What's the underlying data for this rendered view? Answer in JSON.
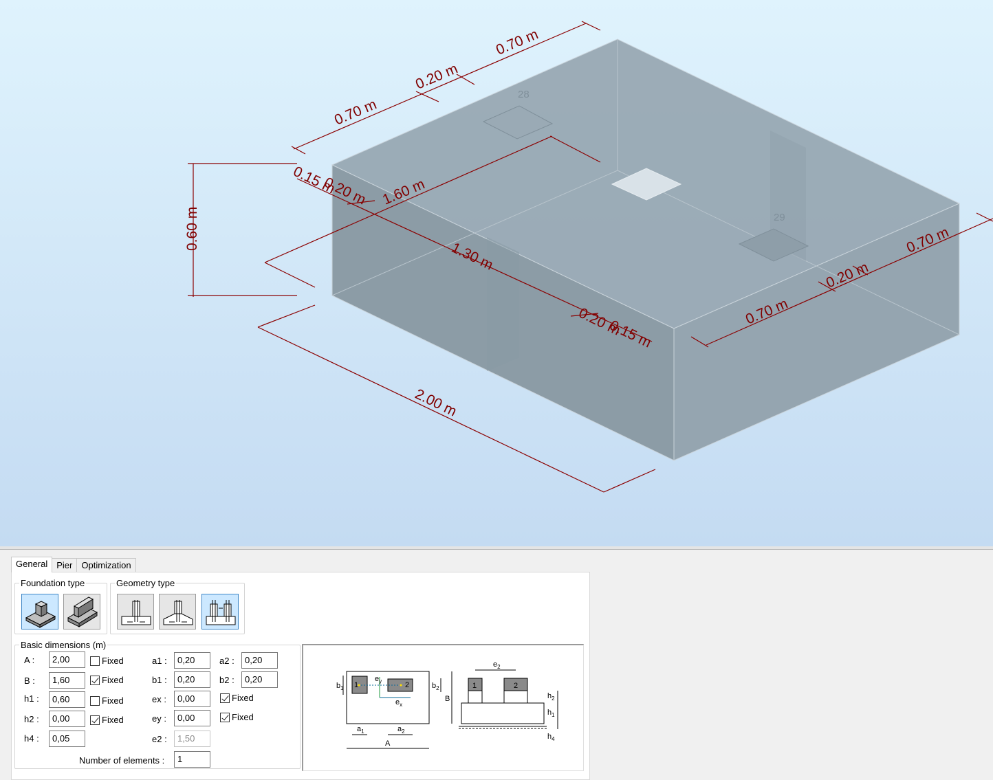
{
  "viewport": {
    "dimensions": {
      "d_top_070_left": "0.70 m",
      "d_top_020": "0.20 m",
      "d_top_070_right": "0.70 m",
      "d_height": "0.60 m",
      "d_015_left": "0.15 m",
      "d_020_left": "0.20 m",
      "d_160": "1.60 m",
      "d_130": "1.30 m",
      "d_020_mid": "0.20 m",
      "d_015_mid": "0.15 m",
      "d_right_070_a": "0.70 m",
      "d_right_020": "0.20 m",
      "d_right_070_b": "0.70 m",
      "d_200": "2.00 m"
    },
    "nodes": {
      "n28": "28",
      "n29": "29"
    },
    "colors": {
      "dimension": "#800000",
      "block_face": "#8c9eaa"
    }
  },
  "panel": {
    "tabs": [
      {
        "label": "General",
        "active": true
      },
      {
        "label": "Pier",
        "active": false
      },
      {
        "label": "Optimization",
        "active": false
      }
    ],
    "foundation_type": {
      "title": "Foundation type",
      "options": [
        {
          "icon": "spread-footing-icon",
          "selected": true
        },
        {
          "icon": "continuous-footing-icon",
          "selected": false
        }
      ]
    },
    "geometry_type": {
      "title": "Geometry type",
      "options": [
        {
          "icon": "rectangular-footing-icon",
          "selected": false
        },
        {
          "icon": "tapered-footing-icon",
          "selected": false
        },
        {
          "icon": "multi-pier-footing-icon",
          "selected": true
        }
      ]
    },
    "basic": {
      "title": "Basic dimensions (m)",
      "A_label": "A :",
      "A_value": "2,00",
      "A_fixed": false,
      "B_label": "B :",
      "B_value": "1,60",
      "B_fixed": true,
      "h1_label": "h1 :",
      "h1_value": "0,60",
      "h1_fixed": false,
      "h2_label": "h2 :",
      "h2_value": "0,00",
      "h2_fixed": true,
      "h4_label": "h4 :",
      "h4_value": "0,05",
      "a1_label": "a1 :",
      "a1_value": "0,20",
      "b1_label": "b1 :",
      "b1_value": "0,20",
      "ex_label": "ex :",
      "ex_value": "0,00",
      "ex_fixed": true,
      "ey_label": "ey :",
      "ey_value": "0,00",
      "ey_fixed": true,
      "e2_label": "e2 :",
      "e2_value": "1,50",
      "a2_label": "a2 :",
      "a2_value": "0,20",
      "b2_label": "b2 :",
      "b2_value": "0,20",
      "fixed_label": "Fixed",
      "elements_label": "Number of elements :",
      "elements_value": "1"
    },
    "schema": {
      "b1": "b",
      "b1_sub": "1",
      "b2": "b",
      "b2_sub": "2",
      "B": "B",
      "A": "A",
      "a1": "a",
      "a1_sub": "1",
      "a2": "a",
      "a2_sub": "2",
      "p1": "1",
      "p2": "2",
      "ex": "e",
      "ex_sub": "x",
      "ey": "e",
      "ey_sub": "y",
      "e2": "e",
      "e2_sub": "2",
      "h1": "h",
      "h1_sub": "1",
      "h2": "h",
      "h2_sub": "2",
      "h4": "h",
      "h4_sub": "4",
      "c1": "1",
      "c2": "2"
    }
  }
}
